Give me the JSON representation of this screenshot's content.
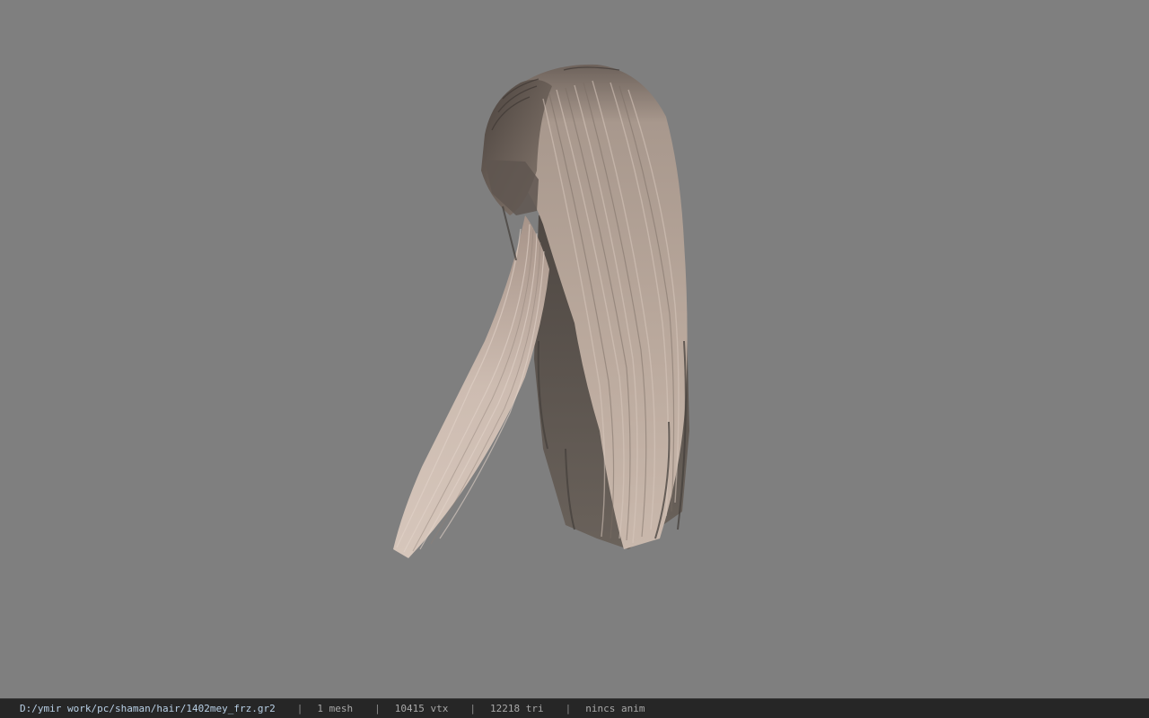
{
  "viewer": {
    "background_color": "#7f7f7f",
    "model": {
      "name": "hair-mesh",
      "colors": {
        "root_dark": "#5a514c",
        "strand_mid": "#a6978d",
        "strand_light": "#cdbcb1",
        "shadow": "#4c4743"
      }
    }
  },
  "statusbar": {
    "file_path": "D:/ymir work/pc/shaman/hair/1402mey_frz.gr2",
    "separator": "|",
    "mesh_count": "1 mesh",
    "vertex_count": "10415 vtx",
    "triangle_count": "12218 tri",
    "anim_status": "nincs anim"
  }
}
